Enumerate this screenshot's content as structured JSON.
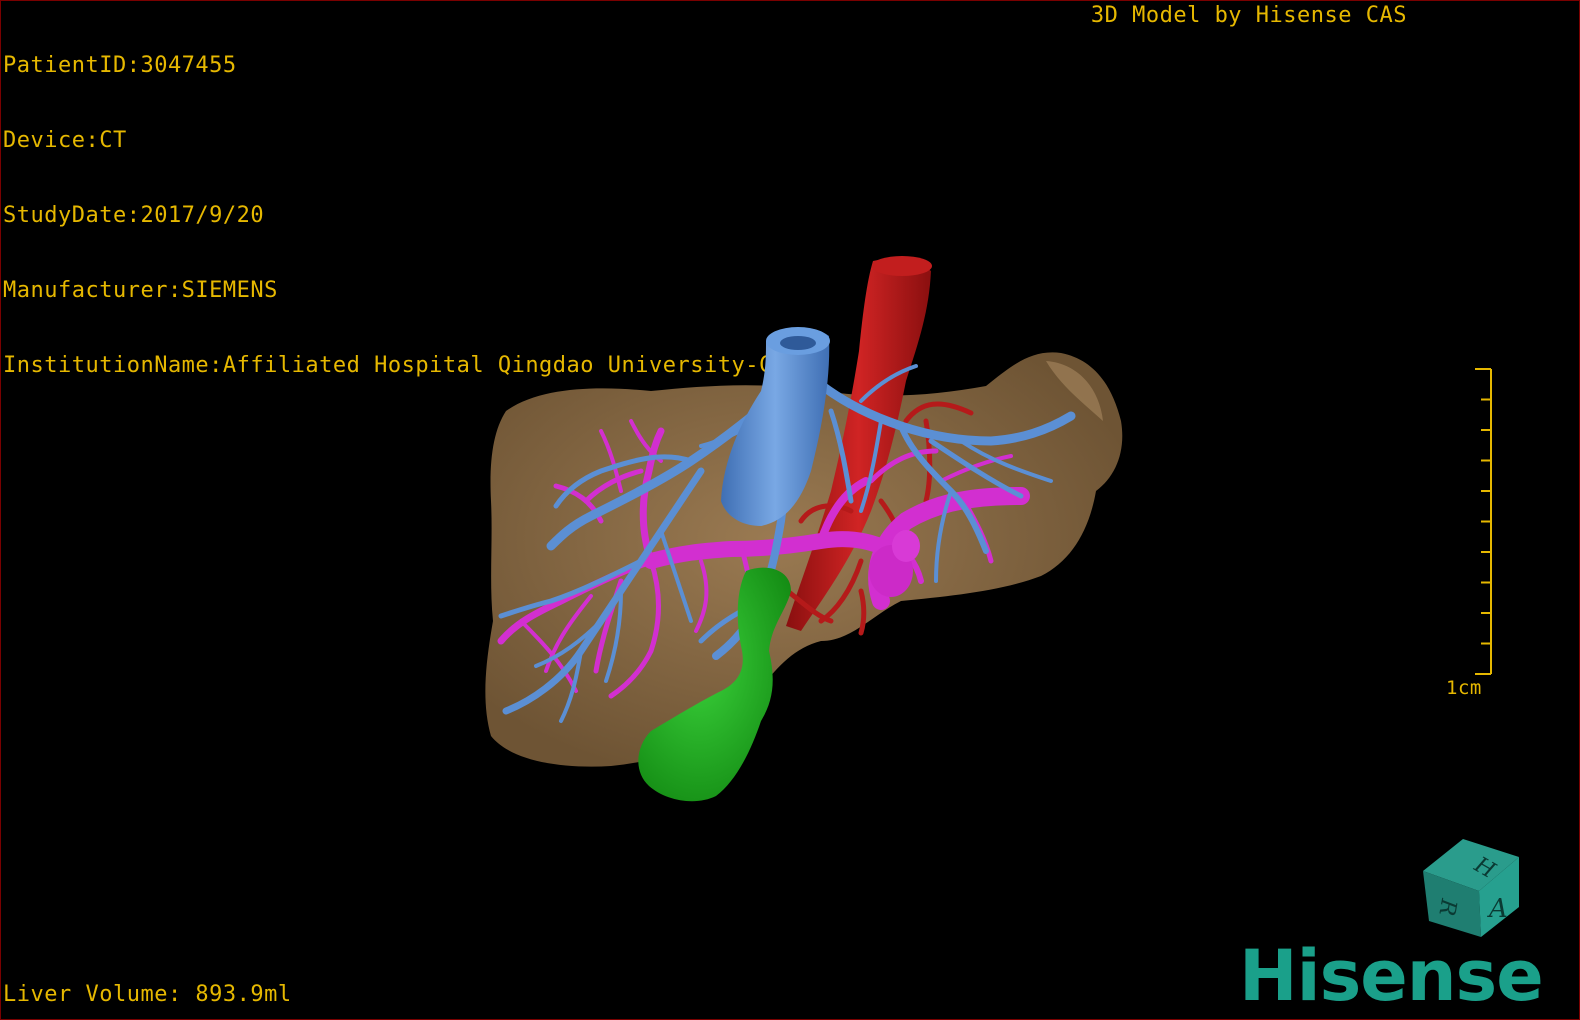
{
  "header": {
    "patient_id": "PatientID:3047455",
    "device": "Device:CT",
    "study_date": "StudyDate:2017/9/20",
    "manufacturer": "Manufacturer:SIEMENS",
    "institution": "InstitutionName:Affiliated Hospital Qingdao University-C"
  },
  "credit": "3D Model by Hisense CAS",
  "footer": {
    "liver_volume": "Liver Volume: 893.9ml"
  },
  "scale_bar": {
    "label": "1cm"
  },
  "orientation_cube": {
    "faces": [
      "H",
      "R",
      "A"
    ]
  },
  "logo": {
    "text": "Hisense"
  },
  "colors": {
    "text": "#e6b800",
    "liver": "#8a6b45",
    "hepatic_vein": "#5b8fd4",
    "portal_vein": "#d22fd0",
    "artery": "#b51a1a",
    "gallbladder": "#1fa51f",
    "brand": "#1aa08a"
  },
  "icons": [
    "orientation-cube-icon",
    "hisense-logo"
  ]
}
